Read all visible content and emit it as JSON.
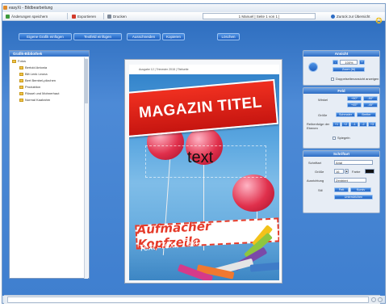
{
  "window": {
    "title": "easyXi - Bildbearbeitung"
  },
  "menubar": {
    "items": [
      {
        "label": "Änderungen speichern"
      },
      {
        "label": "Exportieren"
      },
      {
        "label": "Drucken"
      }
    ],
    "page_info": "1 Manuel | Seite 1 von 1 |",
    "back_label": "Zurück zur Übersicht"
  },
  "toolbar": {
    "buttons": [
      {
        "label": "Eigene Grafik einfügen"
      },
      {
        "label": "Textfeld einfügen"
      },
      {
        "label": "Ausschneiden"
      },
      {
        "label": "Kopieren"
      },
      {
        "label": "Löschen"
      }
    ]
  },
  "tree": {
    "title": "Grafik-Bibliothek",
    "root": "Fotos",
    "items": [
      {
        "label": "Bertold Antonia"
      },
      {
        "label": "Bilt Lenk Leona"
      },
      {
        "label": "Bert Bembel-pilzchen"
      },
      {
        "label": "Produktion"
      },
      {
        "label": "Rüssel und Mohnerhaut"
      },
      {
        "label": "Normal Kaalrahm"
      }
    ]
  },
  "document": {
    "header_text": "Ausgabe 12 | Trimester 2018 | Titelseite",
    "title": "MAGAZIN TITEL",
    "text_placeholder": "text",
    "headline": "Aufmacher Kopfzeile",
    "subline": "Text, Text, Text"
  },
  "right_panel": {
    "ansicht": {
      "title": "Ansicht",
      "zoom_value": "100%",
      "auto_fit_label": "Zoom (fit)",
      "checkbox_label": "Doppelseitenansicht anzeigen"
    },
    "feld": {
      "title": "Feld",
      "rotation_label": "Winkel",
      "rotation_buttons": [
        {
          "label": "+90°"
        },
        {
          "label": "-90°"
        },
        {
          "label": "+45°"
        },
        {
          "label": "-45°"
        }
      ],
      "size_label": "Größe",
      "size_buttons": [
        {
          "label": "Schmaler"
        },
        {
          "label": "Breiter"
        }
      ],
      "order_label": "Reihenfolge der Ebenen",
      "order_buttons": [
        {
          "label": "+1"
        },
        {
          "label": "+2"
        },
        {
          "label": "-1"
        },
        {
          "label": "-2"
        },
        {
          "label": "+3"
        }
      ],
      "mirror_label": "Spiegeln"
    },
    "schrift": {
      "title": "Schriftart",
      "font_label": "Schriftart",
      "font_value": "Arial",
      "size_label": "Größe",
      "size_value": "16",
      "color_label": "Farbe",
      "color_value": "#111111",
      "align_label": "Ausrichtung",
      "align_value": "Zentriert",
      "style_label": "Stil",
      "style_buttons": [
        {
          "label": "Fett"
        },
        {
          "label": "Kursiv"
        },
        {
          "label": "Unterstrichen"
        }
      ]
    }
  },
  "colors": {
    "accent": "#2d6cc4",
    "banner": "#d41c14",
    "headline": "#e53b2a"
  }
}
